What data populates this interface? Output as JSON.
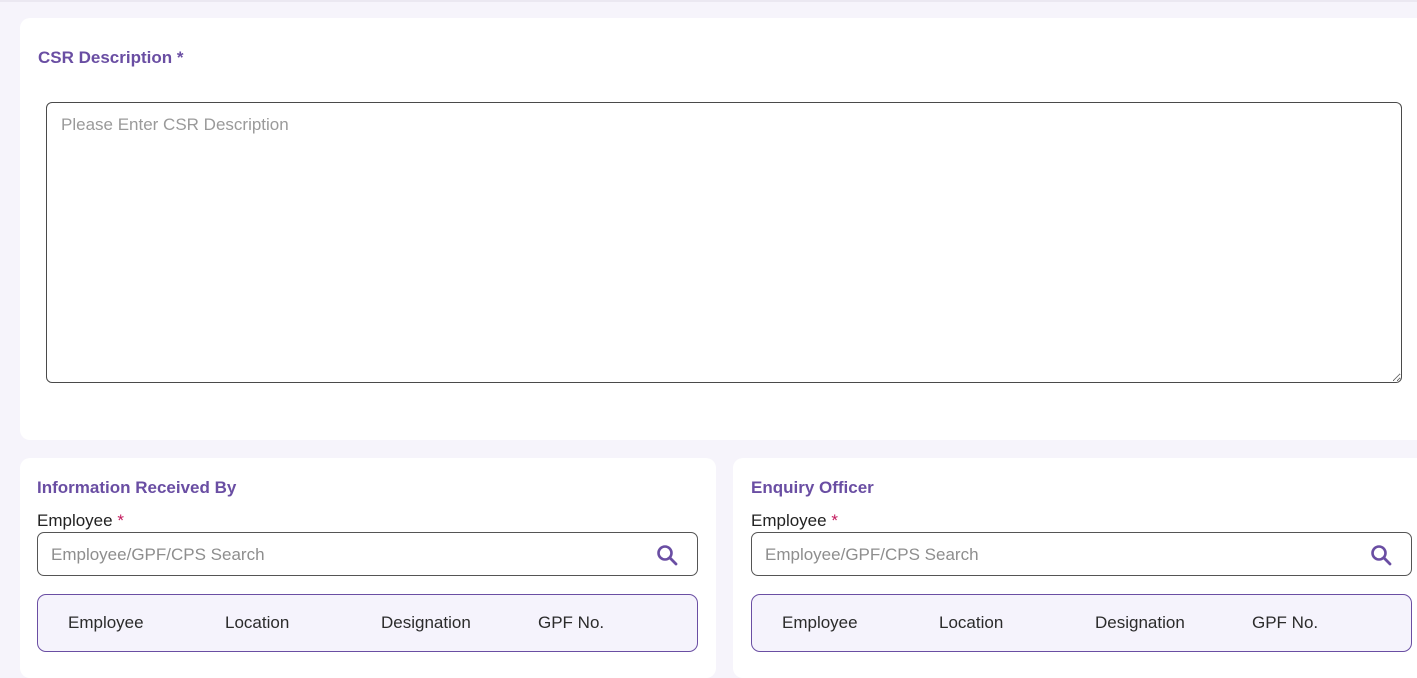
{
  "csr": {
    "title": "CSR Description",
    "required_mark": "*",
    "placeholder": "Please Enter CSR Description"
  },
  "info_received": {
    "title": "Information Received By",
    "employee_label": "Employee",
    "required_mark": "*",
    "search_placeholder": "Employee/GPF/CPS Search",
    "columns": [
      "Employee",
      "Location",
      "Designation",
      "GPF No."
    ]
  },
  "enquiry_officer": {
    "title": "Enquiry Officer",
    "employee_label": "Employee",
    "required_mark": "*",
    "search_placeholder": "Employee/GPF/CPS Search",
    "columns": [
      "Employee",
      "Location",
      "Designation",
      "GPF No."
    ]
  },
  "colors": {
    "accent": "#6a4ea3",
    "required": "#c2185b",
    "page_bg": "#f6f4fb"
  },
  "icons": {
    "search": "search-icon"
  }
}
